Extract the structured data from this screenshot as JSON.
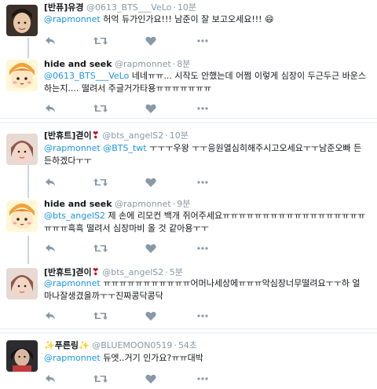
{
  "tweets": [
    {
      "name": "[반퓨]유경",
      "handle": "@0613_BTS___VeLo",
      "time": "10분",
      "mentions": "@rapmonnet",
      "text": "허억 듀가인가요!!! 남준이 잘 보고오세요!!!",
      "emoji": "😄"
    },
    {
      "name": "hide and seek",
      "handle": "@rapmonnet",
      "time": "8분",
      "mentions": "@0613_BTS___VeLo",
      "text": "네네ㅠㅠ... 시작도 안했는데 어쩜 이렇게 심장이 두근두근 바운스 하는지.... 떨려서 주글거가타용ㅠㅠㅠㅠㅠㅠㅠ"
    },
    {
      "name": "[반휴트]겯이",
      "heart": "❣",
      "handle": "@bts_angelS2",
      "time": "10분",
      "mentions": "@rapmonnet @BTS_twt",
      "text": "ㅜㅜㅜ우왕 ㅜㅜ응원열심히해주시고오세요ㅜㅜ남준오빠 든든하겠다ㅜㅜ"
    },
    {
      "name": "hide and seek",
      "handle": "@rapmonnet",
      "time": "9분",
      "mentions": "@bts_angelS2",
      "text": "제 손에 리모컨 백개 쥐어주세요ㅠㅠㅠㅠㅠㅠㅠㅠㅠㅠㅠㅠㅠㅠㅠㅠㅠㅠㅠㅠㅠ흑흑 떨려서 심장마비 올 것 같아용ㅜㅜ"
    },
    {
      "name": "[반휴트]겯이",
      "heart": "❣",
      "handle": "@bts_angelS2",
      "time": "5분",
      "mentions": "@rapmonnet",
      "text": "ㅠㅠㅠㅠㅠㅠㅠㅠㅠㅠㅠ어머나세상에ㅠㅠㅠ악심장너무떨려요ㅜㅜ하 얼마나잘생겼을까ㅜㅜ진짜콩닥콩닥"
    },
    {
      "name": "✨푸른링✨",
      "handle": "@BLUEMOON0519",
      "time": "54초",
      "mentions": "@rapmonnet",
      "text": "듀엣..거기 인가요?ㅠㅠ대박"
    }
  ],
  "colors": {
    "link": "#1b95e0",
    "muted": "#8899a6",
    "icon": "#8899a6",
    "rail": "#ccd6dd",
    "separator": "#e6ecf0"
  },
  "icons": [
    "reply-icon",
    "retweet-icon",
    "like-icon",
    "more-icon"
  ]
}
